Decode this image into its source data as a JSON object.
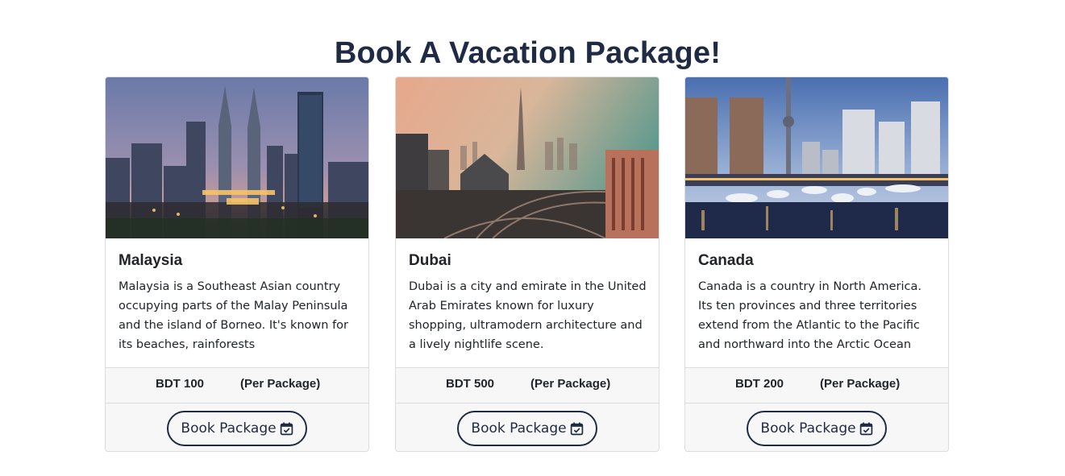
{
  "page": {
    "title": "Book A Vacation Package!"
  },
  "colors": {
    "accent": "#1f2a44",
    "footer_bg": "#f7f7f7",
    "border": "#dcdcdc"
  },
  "packages": [
    {
      "name": "Malaysia",
      "description": "Malaysia is a Southeast Asian country occupying parts of the Malay Peninsula and the island of Borneo. It's known for its beaches, rainforests",
      "price": "BDT 100",
      "price_unit": "(Per Package)",
      "button_label": "Book Package",
      "button_icon": "calendar-check-icon"
    },
    {
      "name": "Dubai",
      "description": "Dubai is a city and emirate in the United Arab Emirates known for luxury shopping, ultramodern architecture and a lively nightlife scene.",
      "price": "BDT 500",
      "price_unit": "(Per Package)",
      "button_label": "Book Package",
      "button_icon": "calendar-check-icon"
    },
    {
      "name": "Canada",
      "description": "Canada is a country in North America. Its ten provinces and three territories extend from the Atlantic to the Pacific and northward into the Arctic Ocean",
      "price": "BDT 200",
      "price_unit": "(Per Package)",
      "button_label": "Book Package",
      "button_icon": "calendar-check-icon"
    }
  ]
}
